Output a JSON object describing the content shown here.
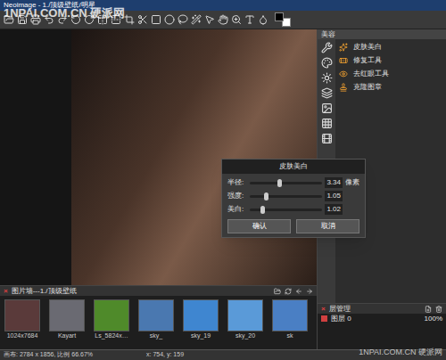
{
  "window": {
    "title": "Neoimage - 1./顶级壁纸/明星"
  },
  "watermarks": [
    "1NPAI.COM.CN 硬派网",
    "1NPAI.COM.CN 硬派网"
  ],
  "colors": {
    "foreground": "#000000",
    "background": "#ffffff"
  },
  "beauty_panel": {
    "title": "美容",
    "tools": [
      {
        "label": "皮肤美白"
      },
      {
        "label": "修复工具"
      },
      {
        "label": "去红眼工具"
      },
      {
        "label": "克隆图章"
      }
    ]
  },
  "dialog": {
    "title": "皮肤美白",
    "sliders": [
      {
        "label": "半径:",
        "level": 0.38,
        "value": "3.34",
        "unit": "像素"
      },
      {
        "label": "强度:",
        "level": 0.2,
        "value": "1.05",
        "unit": ""
      },
      {
        "label": "美白:",
        "level": 0.15,
        "value": "1.02",
        "unit": ""
      }
    ],
    "buttons": [
      "确认",
      "取消"
    ]
  },
  "gallery": {
    "close": "×",
    "title": "图片墙---1./顶级壁纸",
    "thumbnails": [
      {
        "label": "1024x7684",
        "color": "#5a3a3a"
      },
      {
        "label": "Kayart",
        "color": "#6a6a72"
      },
      {
        "label": "Ls_5824x…",
        "color": "#4f8a2a"
      },
      {
        "label": "sky_",
        "color": "#4a78b0"
      },
      {
        "label": "sky_19",
        "color": "#3f86d0"
      },
      {
        "label": "sky_20",
        "color": "#5a9ad8"
      },
      {
        "label": "sk",
        "color": "#4a7fc4"
      }
    ]
  },
  "layers": {
    "close": "×",
    "title": "层管理",
    "rows": [
      {
        "name": "图层 0",
        "opacity": "100%"
      }
    ]
  },
  "status_bar": {
    "canvas": "画布: 2784 x 1856, 比例 66.67%",
    "cursor": "x: 754, y: 159"
  }
}
